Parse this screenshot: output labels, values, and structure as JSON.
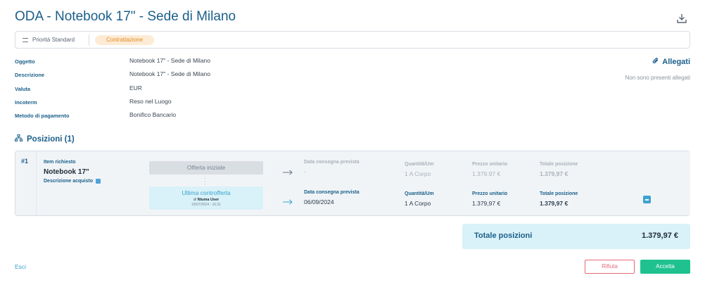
{
  "header": {
    "title": "ODA - Notebook 17\" - Sede di Milano"
  },
  "status_bar": {
    "priority_label": "Priorità Standard",
    "status_badge": "Contrattazione"
  },
  "details": [
    {
      "label": "Oggetto",
      "value": "Notebook 17\" - Sede di Milano"
    },
    {
      "label": "Descrizione",
      "value": "Notebook 17\" - Sede di Milano"
    },
    {
      "label": "Valuta",
      "value": "EUR"
    },
    {
      "label": "Incoterm",
      "value": "Reso nel Luogo"
    },
    {
      "label": "Metodo di pagamento",
      "value": "Bonifico Bancario"
    }
  ],
  "attachments": {
    "title": "Allegati",
    "empty_text": "Non sono presenti allegati"
  },
  "positions": {
    "title": "Posizioni (1)",
    "items": [
      {
        "index": "#1",
        "requested_label": "Item richiesto",
        "name": "Notebook 17\"",
        "description_label": "Descrizione acquisto",
        "initial_offer": {
          "label": "Offerta iniziale",
          "delivery_label": "Data consegna prevista",
          "delivery_value": "-",
          "qty_label": "Quantità/Um",
          "qty_value": "1 A Corpo",
          "unit_price_label": "Prezzo unitario",
          "unit_price_value": "1.379,97 €",
          "total_label": "Totale posizione",
          "total_value": "1.379,97 €"
        },
        "last_counteroffer": {
          "label": "Ultima controfferta",
          "by_prefix": "di",
          "by_user": "Niuma User",
          "datetime": "19/07/2024 - 16:31",
          "delivery_label": "Data consegna prevista",
          "delivery_value": "06/09/2024",
          "qty_label": "Quantità/Um",
          "qty_value": "1 A Corpo",
          "unit_price_label": "Prezzo unitario",
          "unit_price_value": "1.379,97 €",
          "total_label": "Totale posizione",
          "total_value": "1.379,97 €"
        }
      }
    ]
  },
  "totals": {
    "label": "Totale posizioni",
    "value": "1.379,97 €"
  },
  "footer": {
    "exit_label": "Esci",
    "reject_label": "Rifiuta",
    "accept_label": "Accetta"
  },
  "colors": {
    "accent": "#1a5f8a",
    "link": "#3ba3d0",
    "accept": "#1fc28f",
    "reject": "#e46a7a",
    "status_badge_bg": "#fdebd5",
    "status_badge_text": "#e08a1e"
  }
}
